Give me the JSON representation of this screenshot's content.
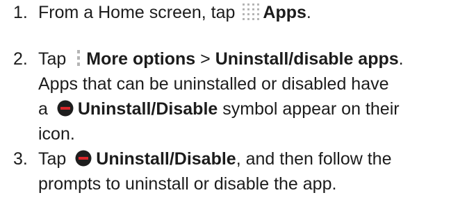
{
  "steps": [
    {
      "number": "1.",
      "lines": [
        {
          "prefix": "From a Home screen, tap ",
          "icon": "apps-grid-icon",
          "bold": "Apps",
          "suffix": "."
        }
      ]
    },
    {
      "number": "2.",
      "line1": {
        "prefix": "Tap ",
        "icon": "more-options-icon",
        "bold1": "More options",
        "sep": " > ",
        "bold2": "Uninstall/disable apps",
        "suffix": "."
      },
      "line2": "Apps that can be uninstalled or disabled have",
      "line3": {
        "prefix": "a ",
        "icon": "uninstall-disable-icon",
        "bold": "Uninstall/Disable",
        "suffix": " symbol appear on their"
      },
      "line4": "icon."
    },
    {
      "number": "3.",
      "line1": {
        "prefix": "Tap ",
        "icon": "uninstall-disable-icon",
        "bold": "Uninstall/Disable",
        "suffix": ", and then follow the"
      },
      "line2": "prompts to uninstall or disable the app."
    }
  ],
  "colors": {
    "text": "#1c1c1c",
    "icon_dark": "#1e1e1e",
    "icon_red": "#d9262a",
    "icon_grey": "#b5b5b5"
  }
}
